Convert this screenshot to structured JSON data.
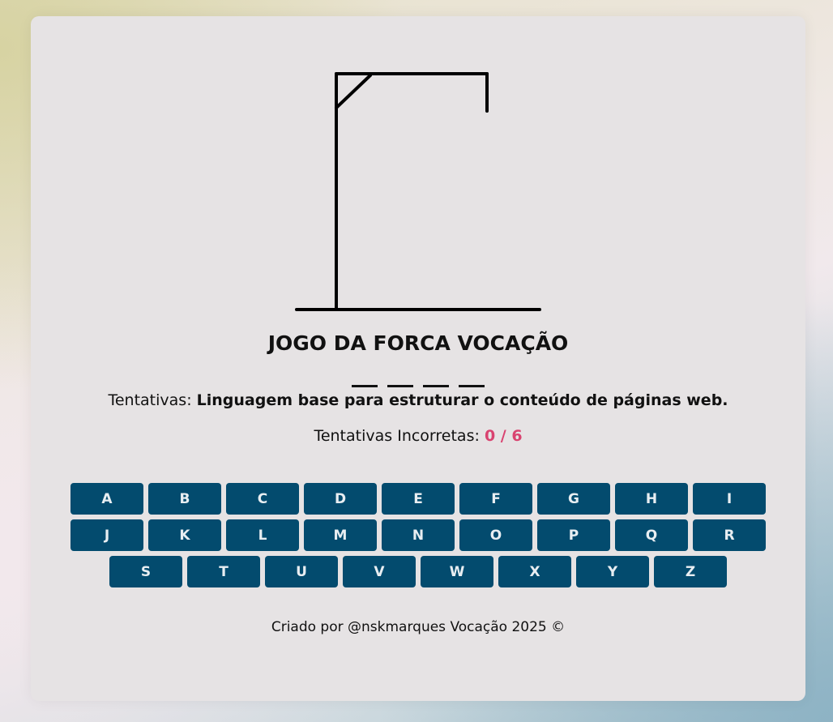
{
  "game": {
    "title": "JOGO DA FORCA VOCAÇÃO",
    "hint_label": "Tentativas:",
    "hint_text": "Linguagem base para estruturar o conteúdo de páginas web.",
    "word_slots": [
      "",
      "",
      "",
      ""
    ],
    "incorrect_label": "Tentativas Incorretas:",
    "incorrect_count": "0 / 6",
    "wrong_guesses": 0,
    "max_guesses": 6
  },
  "keyboard": {
    "rows": [
      [
        "A",
        "B",
        "C",
        "D",
        "E",
        "F",
        "G",
        "H",
        "I"
      ],
      [
        "J",
        "K",
        "L",
        "M",
        "N",
        "O",
        "P",
        "Q",
        "R"
      ],
      [
        "S",
        "T",
        "U",
        "V",
        "W",
        "X",
        "Y",
        "Z"
      ]
    ]
  },
  "footer": {
    "text": "Criado por @nskmarques Vocação 2025 ©"
  },
  "colors": {
    "key_background": "#034b6e",
    "key_text": "#e8eef2",
    "count_accent": "#d94370",
    "card_background": "#e6e3e4"
  }
}
